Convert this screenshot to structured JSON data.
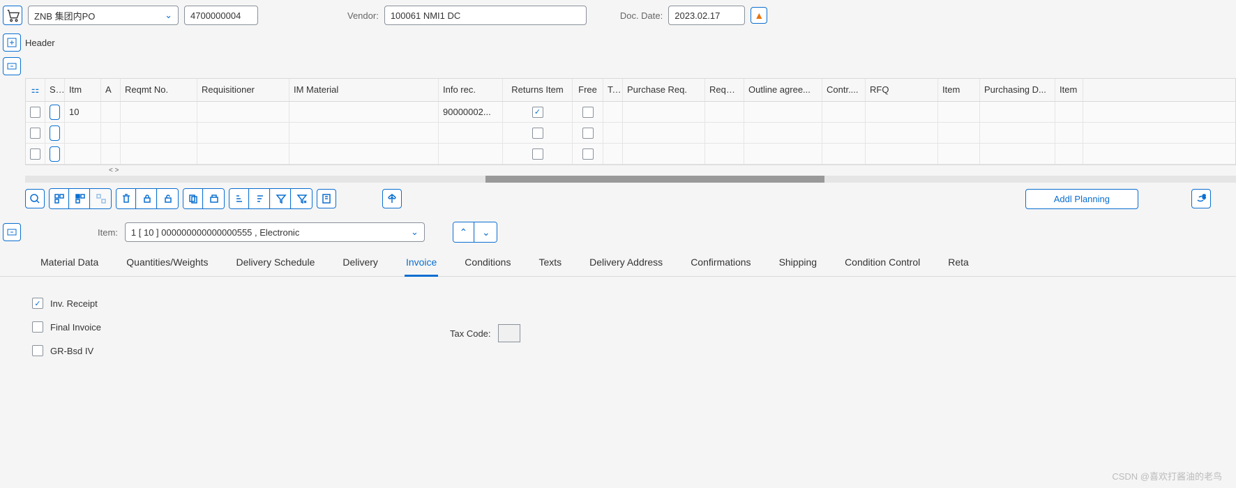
{
  "header": {
    "po_type": "ZNB 集团内PO",
    "po_number": "4700000004",
    "vendor_label": "Vendor:",
    "vendor": "100061 NMI1 DC",
    "doc_date_label": "Doc. Date:",
    "doc_date": "2023.02.17",
    "header_label": "Header"
  },
  "table": {
    "columns": [
      "S...",
      "Itm",
      "A",
      "Reqmt No.",
      "Requisitioner",
      "IM Material",
      "Info rec.",
      "Returns Item",
      "Free",
      "T...",
      "Purchase Req.",
      "Requi...",
      "Outline agree...",
      "Contr....",
      "RFQ",
      "Item",
      "Purchasing D...",
      "Item"
    ],
    "rows": [
      {
        "itm": "10",
        "info_rec": "90000002...",
        "returns": true,
        "free": false
      },
      {
        "itm": "",
        "info_rec": "",
        "returns": false,
        "free": false
      },
      {
        "itm": "",
        "info_rec": "",
        "returns": false,
        "free": false
      }
    ]
  },
  "toolbar": {
    "addl_planning": "Addl Planning"
  },
  "item_detail": {
    "item_label": "Item:",
    "item_value": "1 [ 10 ] 000000000000000555 , Electronic"
  },
  "tabs": [
    "Material Data",
    "Quantities/Weights",
    "Delivery Schedule",
    "Delivery",
    "Invoice",
    "Conditions",
    "Texts",
    "Delivery Address",
    "Confirmations",
    "Shipping",
    "Condition Control",
    "Reta"
  ],
  "active_tab": "Invoice",
  "invoice": {
    "inv_receipt": "Inv. Receipt",
    "final_invoice": "Final Invoice",
    "gr_bsd": "GR-Bsd IV",
    "tax_code_label": "Tax Code:",
    "inv_receipt_checked": true,
    "final_invoice_checked": false,
    "gr_bsd_checked": false
  },
  "watermark": "CSDN @喜欢打酱油的老鸟"
}
